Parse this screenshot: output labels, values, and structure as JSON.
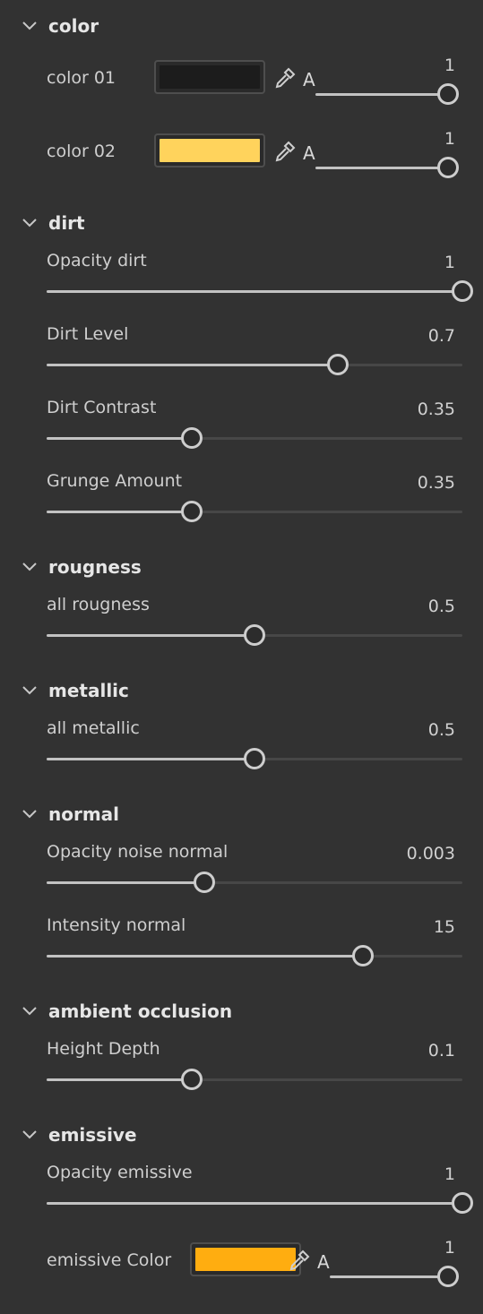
{
  "sections": {
    "color": {
      "title": "color"
    },
    "dirt": {
      "title": "dirt"
    },
    "rougness": {
      "title": "rougness"
    },
    "metallic": {
      "title": "metallic"
    },
    "normal": {
      "title": "normal"
    },
    "ao": {
      "title": "ambient occlusion"
    },
    "emissive": {
      "title": "emissive"
    }
  },
  "color_params": [
    {
      "label": "color 01",
      "swatch": "#1c1c1c",
      "alpha_label": "A",
      "alpha_value": "1",
      "alpha_fraction": 1.0
    },
    {
      "label": "color 02",
      "swatch": "#ffd35c",
      "alpha_label": "A",
      "alpha_value": "1",
      "alpha_fraction": 1.0
    }
  ],
  "sliders": {
    "opacity_dirt": {
      "label": "Opacity dirt",
      "value": "1",
      "fraction": 1.0
    },
    "dirt_level": {
      "label": "Dirt Level",
      "value": "0.7",
      "fraction": 0.7
    },
    "dirt_contrast": {
      "label": "Dirt Contrast",
      "value": "0.35",
      "fraction": 0.35
    },
    "grunge_amount": {
      "label": "Grunge Amount",
      "value": "0.35",
      "fraction": 0.35
    },
    "all_rougness": {
      "label": "all rougness",
      "value": "0.5",
      "fraction": 0.5
    },
    "all_metallic": {
      "label": "all metallic",
      "value": "0.5",
      "fraction": 0.5
    },
    "opacity_noise_normal": {
      "label": "Opacity noise normal",
      "value": "0.003",
      "fraction": 0.38
    },
    "intensity_normal": {
      "label": "Intensity normal",
      "value": "15",
      "fraction": 0.76
    },
    "height_depth": {
      "label": "Height Depth",
      "value": "0.1",
      "fraction": 0.35
    },
    "opacity_emissive": {
      "label": "Opacity emissive",
      "value": "1",
      "fraction": 1.0
    }
  },
  "emissive_color": {
    "label": "emissive Color",
    "swatch": "#ffad10",
    "alpha_label": "A",
    "alpha_value": "1",
    "alpha_fraction": 1.0
  },
  "icons": {
    "section_toggle": "chevron-down-icon",
    "color_picker": "eyedropper-icon"
  },
  "colors": {
    "background": "#323232",
    "track": "#474747",
    "track_fill": "#c2c2c2",
    "knob_border": "#cdcdcd"
  }
}
